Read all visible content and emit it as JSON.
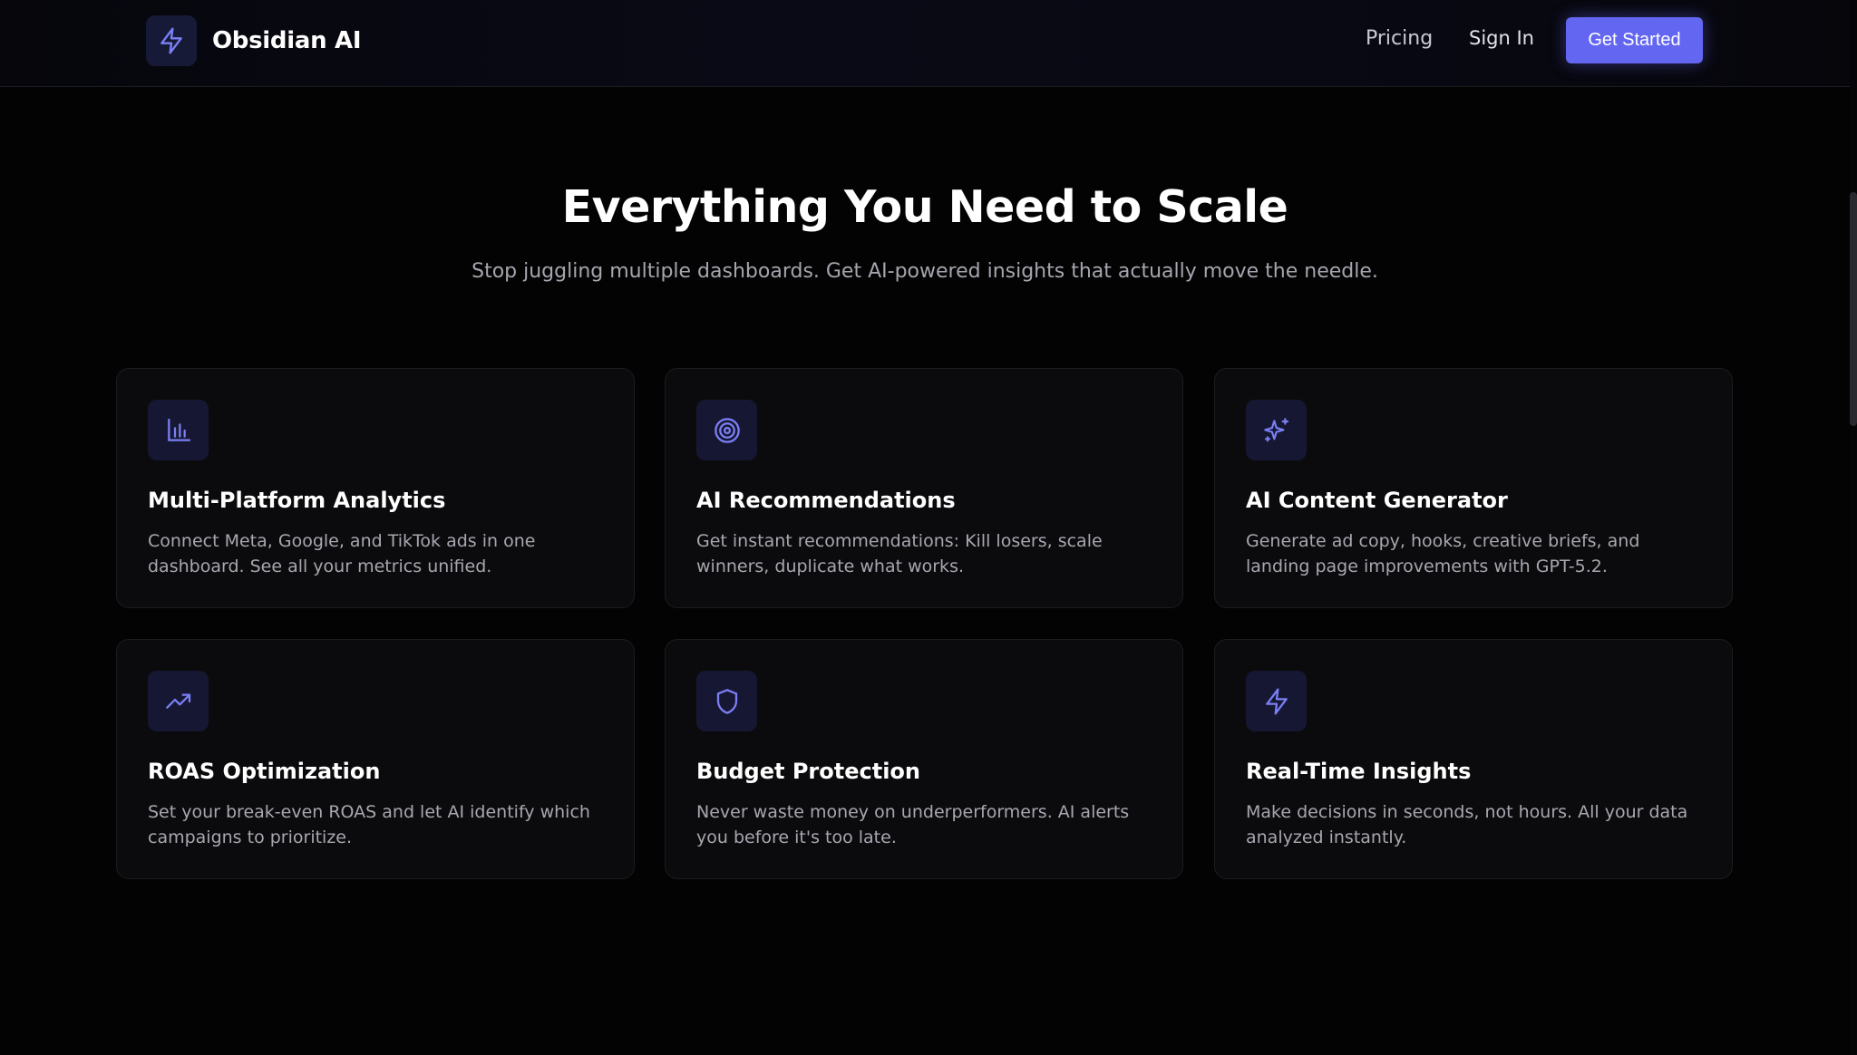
{
  "header": {
    "brand": "Obsidian AI",
    "brand_icon": "lightning-icon",
    "nav_pricing": "Pricing",
    "nav_signin": "Sign In",
    "cta": "Get Started"
  },
  "hero": {
    "title": "Everything You Need to Scale",
    "subtitle": "Stop juggling multiple dashboards. Get AI-powered insights that actually move the needle."
  },
  "colors": {
    "accent": "#6366f1",
    "icon_bg": "#161833",
    "card_bg": "#0b0b0d"
  },
  "features": [
    {
      "icon": "bar-chart-icon",
      "title": "Multi-Platform Analytics",
      "desc": "Connect Meta, Google, and TikTok ads in one dashboard. See all your metrics unified."
    },
    {
      "icon": "target-icon",
      "title": "AI Recommendations",
      "desc": "Get instant recommendations: Kill losers, scale winners, duplicate what works."
    },
    {
      "icon": "sparkles-icon",
      "title": "AI Content Generator",
      "desc": "Generate ad copy, hooks, creative briefs, and landing page improvements with GPT-5.2."
    },
    {
      "icon": "trending-up-icon",
      "title": "ROAS Optimization",
      "desc": "Set your break-even ROAS and let AI identify which campaigns to prioritize."
    },
    {
      "icon": "shield-icon",
      "title": "Budget Protection",
      "desc": "Never waste money on underperformers. AI alerts you before it's too late."
    },
    {
      "icon": "lightning-icon",
      "title": "Real-Time Insights",
      "desc": "Make decisions in seconds, not hours. All your data analyzed instantly."
    }
  ]
}
